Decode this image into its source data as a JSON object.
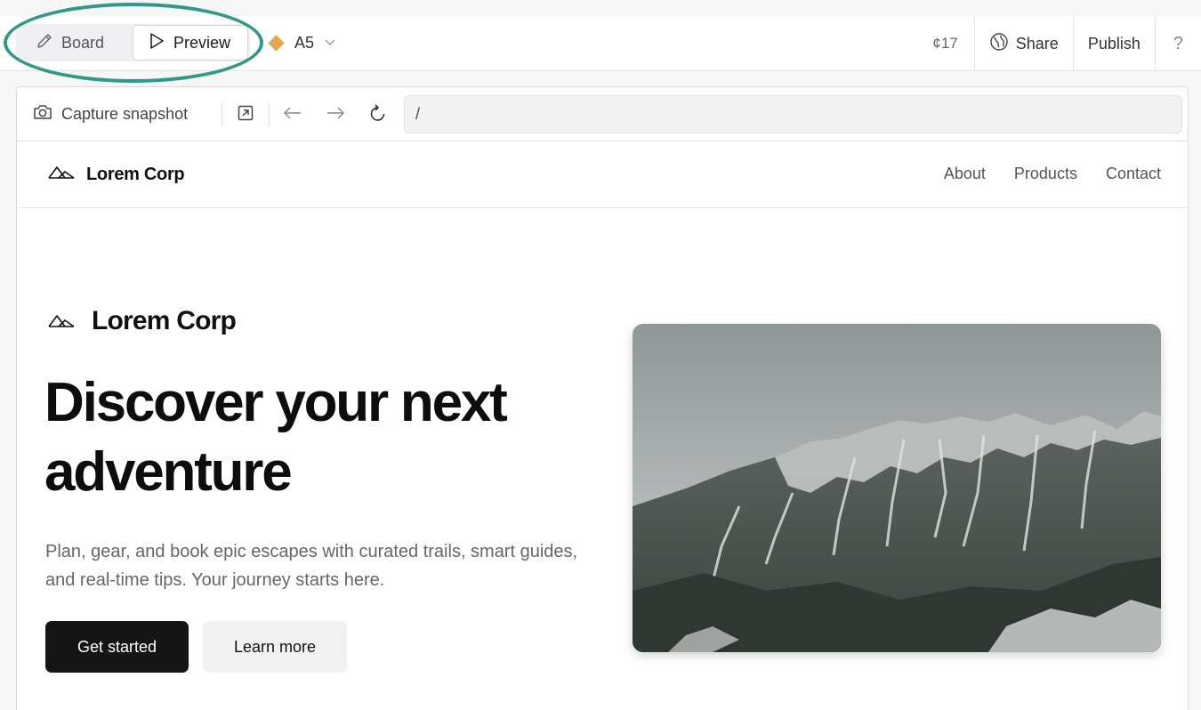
{
  "toolbar": {
    "board_label": "Board",
    "preview_label": "Preview",
    "project_name": "A5",
    "credits": "¢17",
    "share_label": "Share",
    "publish_label": "Publish",
    "help_label": "?"
  },
  "browser": {
    "capture_label": "Capture snapshot",
    "url_value": "/"
  },
  "site": {
    "brand": "Lorem Corp",
    "nav": [
      "About",
      "Products",
      "Contact"
    ],
    "hero": {
      "brand": "Lorem Corp",
      "title": "Discover your next adventure",
      "subtitle": "Plan, gear, and book epic escapes with curated trails, smart guides, and real-time tips. Your journey starts here.",
      "primary_cta": "Get started",
      "secondary_cta": "Learn more"
    }
  },
  "colors": {
    "highlight": "#2c9a87",
    "project_dot": "#e8a74a",
    "primary_button": "#151515"
  },
  "icons": [
    "pencil-icon",
    "play-icon",
    "diamond-icon",
    "chevron-down-icon",
    "globe-icon",
    "camera-icon",
    "open-external-icon",
    "arrow-left-icon",
    "arrow-right-icon",
    "reload-icon",
    "mountain-logo-icon"
  ]
}
